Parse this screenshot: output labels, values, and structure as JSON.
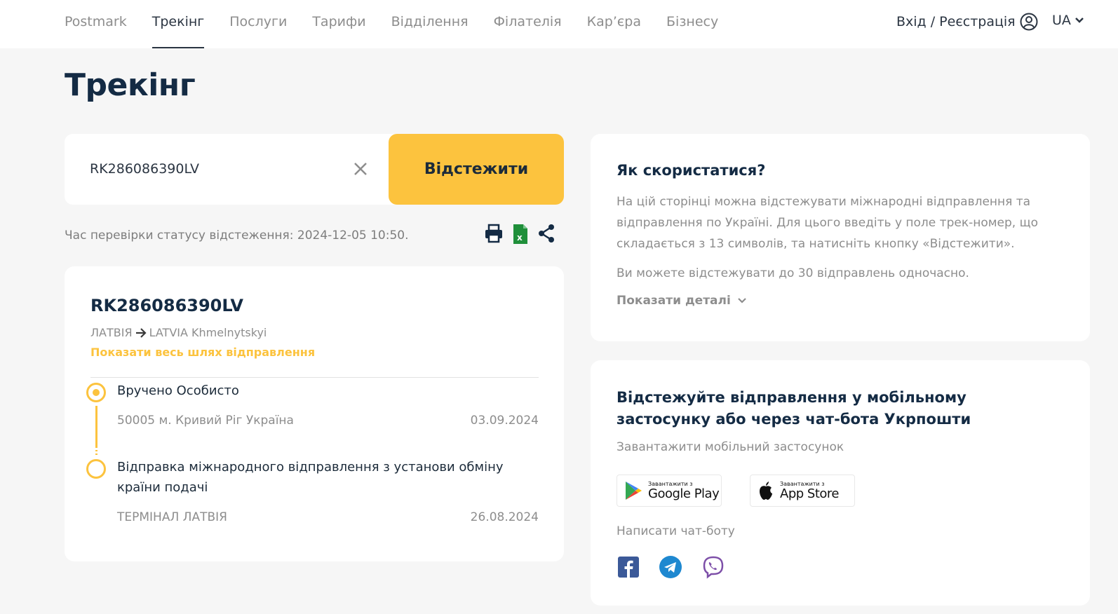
{
  "header": {
    "nav": [
      {
        "label": "Postmark",
        "active": false
      },
      {
        "label": "Трекінг",
        "active": true
      },
      {
        "label": "Послуги",
        "active": false
      },
      {
        "label": "Тарифи",
        "active": false
      },
      {
        "label": "Відділення",
        "active": false
      },
      {
        "label": "Філателія",
        "active": false
      },
      {
        "label": "Кар’єра",
        "active": false
      },
      {
        "label": "Бізнесу",
        "active": false
      }
    ],
    "login_label": "Вхід / Реєстрація",
    "lang": "UA"
  },
  "page_title": "Трекінг",
  "search": {
    "value": "RK286086390LV",
    "button_label": "Відстежити"
  },
  "check_time": "Час перевірки статусу відстеження: 2024-12-05 10:50.",
  "tracking": {
    "number": "RK286086390LV",
    "origin": "ЛАТВІЯ",
    "destination": "LATVIA Khmelnytskyi",
    "show_path_label": "Показати весь шлях відправлення",
    "events": [
      {
        "title": "Вручено Особисто",
        "place": "50005 м. Кривий Ріг Україна",
        "date": "03.09.2024"
      },
      {
        "title": "Відправка міжнародного відправлення з установи обміну країни подачі",
        "place": "ТЕРМІНАЛ ЛАТВІЯ",
        "date": "26.08.2024"
      }
    ]
  },
  "help": {
    "title": "Як скористатися?",
    "text1": "На цій сторінці можна відстежувати міжнародні відправлення та відправлення по Україні. Для цього введіть у поле трек-номер, що складається з 13 символів, та натисніть кнопку «Відстежити».",
    "text2": "Ви можете відстежувати до 30 відправлень одночасно.",
    "details_label": "Показати деталі"
  },
  "app": {
    "title": "Відстежуйте відправлення у мобільному застосунку або через чат-бота Укрпошти",
    "download_label": "Завантажити мобільний застосунок",
    "google_small": "Завантажити з",
    "google_big": "Google Play",
    "apple_small": "Завантажити з",
    "apple_big": "App Store",
    "chatbot_label": "Написати чат-боту"
  },
  "colors": {
    "accent": "#fcc33e",
    "title": "#142b44",
    "muted": "#8d8d8d",
    "background": "#f6f6f6"
  }
}
